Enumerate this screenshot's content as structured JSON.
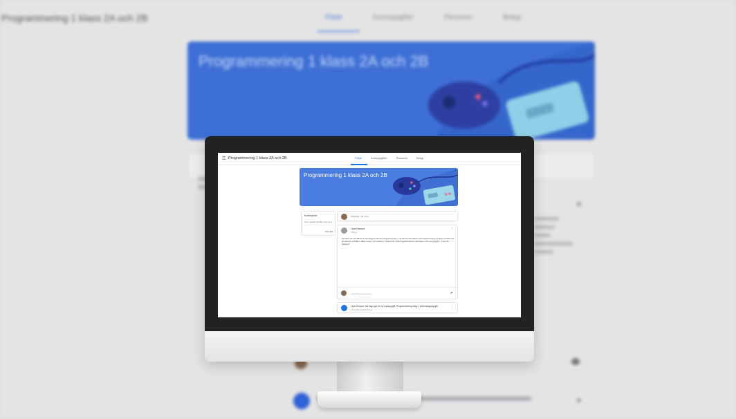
{
  "background_page": {
    "title": "Programmering 1 klass 2A och 2B",
    "tabs": [
      {
        "label": "Flöde",
        "active": true
      },
      {
        "label": "Kursuppgifter",
        "active": false
      },
      {
        "label": "Personer",
        "active": false
      },
      {
        "label": "Betyg",
        "active": false
      }
    ],
    "banner_title": "Programmering 1 klass 2A och 2B"
  },
  "screen": {
    "menu_icon": "☰",
    "title": "Programmering 1 klass 2A och 2B",
    "tabs": [
      {
        "label": "Flöde",
        "active": true
      },
      {
        "label": "Kursuppgifter",
        "active": false
      },
      {
        "label": "Personer",
        "active": false
      },
      {
        "label": "Betyg",
        "active": false
      }
    ],
    "banner_title": "Programmering 1 klass 2A och 2B",
    "upcoming": {
      "title": "Kommande",
      "text": "Inga uppgifter förfaller inom kort",
      "view_all": "Visa alla"
    },
    "share_placeholder": "Meddela i din kurs",
    "post": {
      "author": "Lars Ericsson",
      "date": "11 aug",
      "body": "Hej klass 2A och 2B! Nu är det dags för vår kurs Programmering 1. Vi kommer att arbeta med programmering i Python och lära oss grunderna i variabler, villkor, loopar och funktioner. Titta in här i flödet regelbundet för information och nya uppgifter. Vi ses på lektionen!",
      "comment_placeholder": "Lägg till kurskommentar...",
      "send_icon": "➤",
      "more_icon": "⋮"
    },
    "assignment": {
      "title": "Lars Ericsson har lagt upp en ny kursuppgift: Programmering steg 1 Inlämningsuppgift",
      "date": "24 aug (Redigerad 24 aug)",
      "more_icon": "⋮"
    }
  },
  "colors": {
    "accent": "#1a73e8",
    "banner": "#4a7ddf",
    "bezel": "#222222"
  }
}
